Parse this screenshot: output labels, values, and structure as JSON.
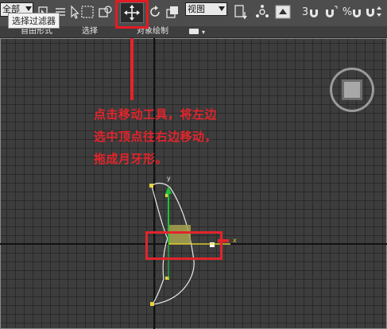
{
  "toolbar": {
    "selector_value": "全部",
    "tooltip": "选择过滤器",
    "view_value": "视图",
    "snap_3": "3",
    "snap_2": "2",
    "snap_percent": "%"
  },
  "ribbon": {
    "tab_freeform": "自由形式",
    "tab_select": "选择",
    "tab_paint": "对象绘制"
  },
  "annotation": {
    "line1": "点击移动工具，将左边",
    "line2": "选中顶点往右边移动，",
    "line3": "拖成月牙形。"
  },
  "gizmo": {
    "y_label": "y",
    "x_label": "x"
  },
  "colors": {
    "accent": "#e3242b",
    "viewport_bg": "#3d3d3d",
    "grid_line": "#2a2a2a",
    "gizmo_y": "#1fbf3a",
    "gizmo_plane": "#c9c16a",
    "vertex": "#e8d23a"
  }
}
